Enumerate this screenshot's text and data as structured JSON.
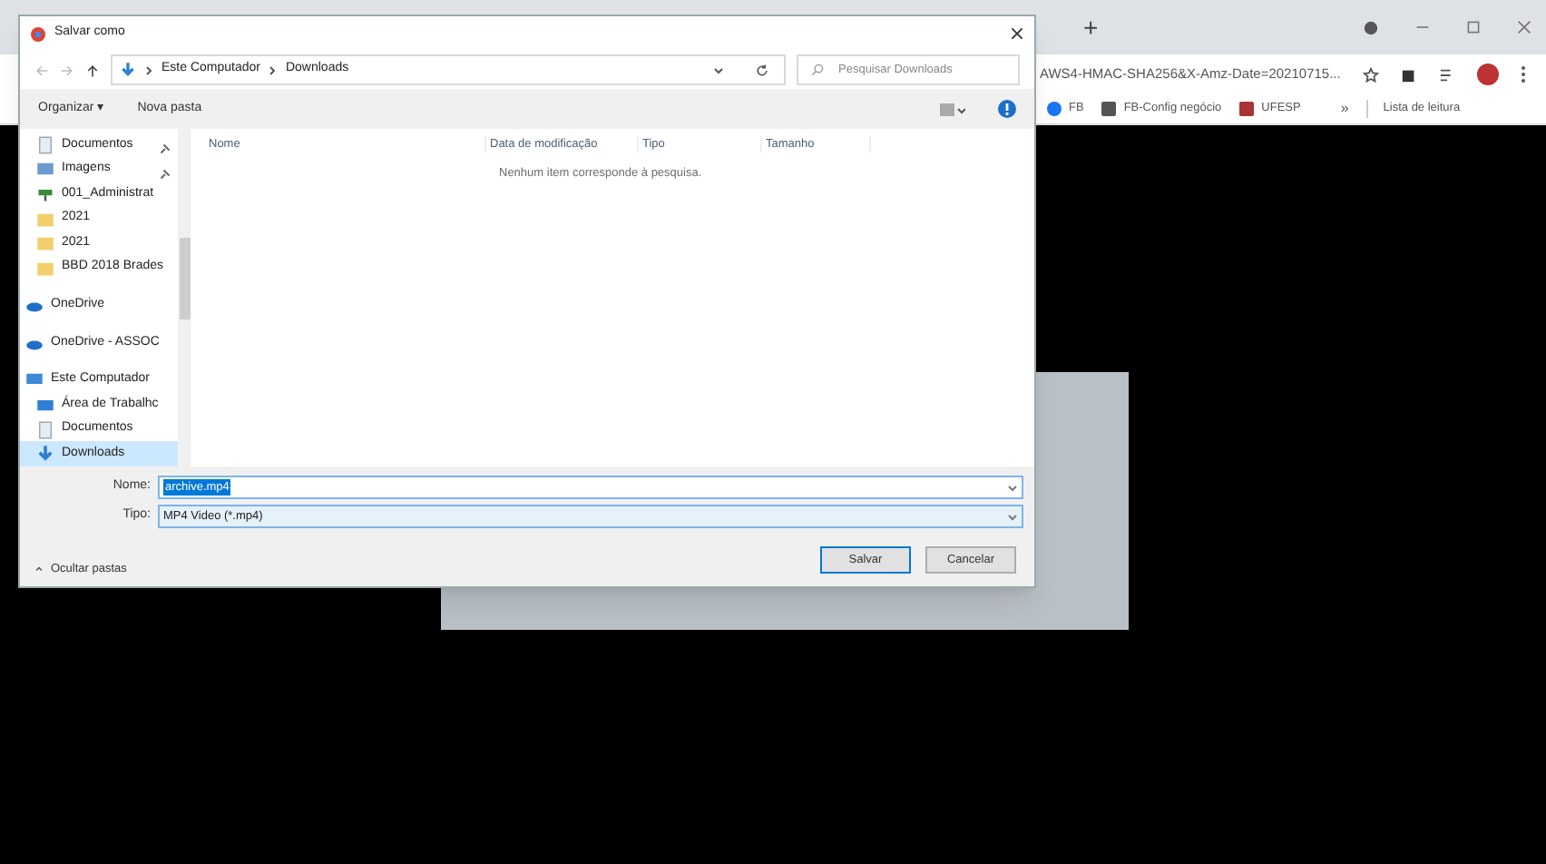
{
  "browser": {
    "new_tab": "+",
    "address": "AWS4-HMAC-SHA256&X-Amz-Date=20210715...",
    "bookmarks": [
      "FB",
      "FB-Config negócio",
      "UFESP"
    ],
    "more_bookmarks": "»",
    "reading_list": "Lista de leitura"
  },
  "dialog": {
    "title": "Salvar como",
    "path": [
      "Este Computador",
      "Downloads"
    ],
    "search": {
      "placeholder": "Pesquisar Downloads"
    },
    "toolbar": {
      "organize": "Organizar ▾",
      "new_folder": "Nova pasta"
    },
    "sidebar": [
      {
        "label": "Documentos",
        "kind": "doc",
        "pinned": true,
        "selected": false
      },
      {
        "label": "Imagens",
        "kind": "image",
        "pinned": true,
        "selected": false
      },
      {
        "label": "001_Administrat",
        "kind": "network",
        "pinned": false,
        "selected": false
      },
      {
        "label": "2021",
        "kind": "folder",
        "pinned": false,
        "selected": false
      },
      {
        "label": "2021",
        "kind": "folder",
        "pinned": false,
        "selected": false
      },
      {
        "label": "BBD 2018 Brades",
        "kind": "folder",
        "pinned": false,
        "selected": false
      },
      {
        "label": "OneDrive",
        "kind": "cloud",
        "pinned": false,
        "selected": false
      },
      {
        "label": "OneDrive - ASSOC",
        "kind": "cloud",
        "pinned": false,
        "selected": false
      },
      {
        "label": "Este Computador",
        "kind": "computer",
        "pinned": false,
        "selected": false,
        "children": [
          {
            "label": "Área de Trabalhc",
            "kind": "desktop",
            "pinned": false,
            "selected": false
          },
          {
            "label": "Documentos",
            "kind": "doc",
            "pinned": false,
            "selected": false
          },
          {
            "label": "Downloads",
            "kind": "download",
            "pinned": false,
            "selected": true
          }
        ]
      }
    ],
    "columns": [
      "Nome",
      "Data de modificação",
      "Tipo",
      "Tamanho"
    ],
    "empty_message": "Nenhum item corresponde à pesquisa.",
    "name_label": "Nome:",
    "name_value": "archive.mp4",
    "type_label": "Tipo:",
    "type_value": "MP4 Video (*.mp4)",
    "hide_folders": "Ocultar pastas",
    "buttons": [
      "Salvar",
      "Cancelar"
    ]
  }
}
